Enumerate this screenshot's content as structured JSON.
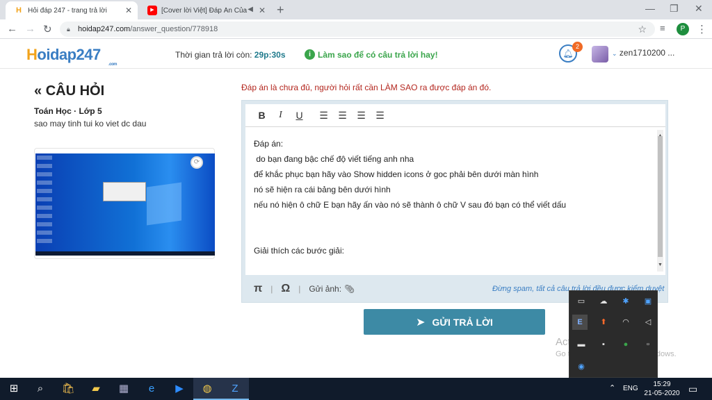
{
  "browser": {
    "tabs": [
      {
        "title": "Hỏi đáp 247 - trang trả lời",
        "favicon": "H"
      },
      {
        "title": "[Cover lời Việt] Đáp Án Của",
        "favicon": "▶"
      }
    ],
    "url_domain": "hoidap247.com",
    "url_path": "/answer_question/778918",
    "profile_initial": "P"
  },
  "site": {
    "logo_h": "H",
    "logo_rest": "oidap247",
    "logo_com": ".com",
    "timer_label": "Thời gian trả lời còn:",
    "timer_value": "29p:30s",
    "tip": "Làm sao để có câu trả lời hay!",
    "notification_count": "2",
    "username": "zen1710200 ..."
  },
  "question": {
    "heading": "CÂU HỎI",
    "meta": "Toán Học · Lớp 5",
    "text": "sao may tinh tui ko viet dc dau"
  },
  "answer": {
    "warning": "Đáp án là chưa đủ, người hỏi rất cần LÀM SAO ra được đáp án đó.",
    "toolbar": [
      "B",
      "I",
      "U"
    ],
    "lines": [
      "Đáp án:",
      " do bạn đang bậc chế độ viết tiếng anh nha",
      "để khắc phục bạn hãy vào Show hidden icons ở goc phải bên dưới màn hình",
      "nó sẽ hiện ra cái bảng bên dưới hình",
      "nếu nó hiện ô chữ E bạn hãy ấn vào nó sẽ thành ô chữ V sau đó bạn có thể viết dấu",
      "",
      "",
      "Giải thích các bước giải:"
    ],
    "pi": "π",
    "omega": "Ω",
    "attach_label": "Gửi ảnh:",
    "spam_notice": "Đừng spam, tất cả câu trả lời đều được kiểm duyệt",
    "submit": "GỬI TRẢ LỜI"
  },
  "watermark": {
    "line1": "Activate Windows",
    "line2": "Go to Settings to activate Windows."
  },
  "taskbar": {
    "time": "15:29",
    "date": "21-05-2020",
    "lang": "ENG"
  }
}
